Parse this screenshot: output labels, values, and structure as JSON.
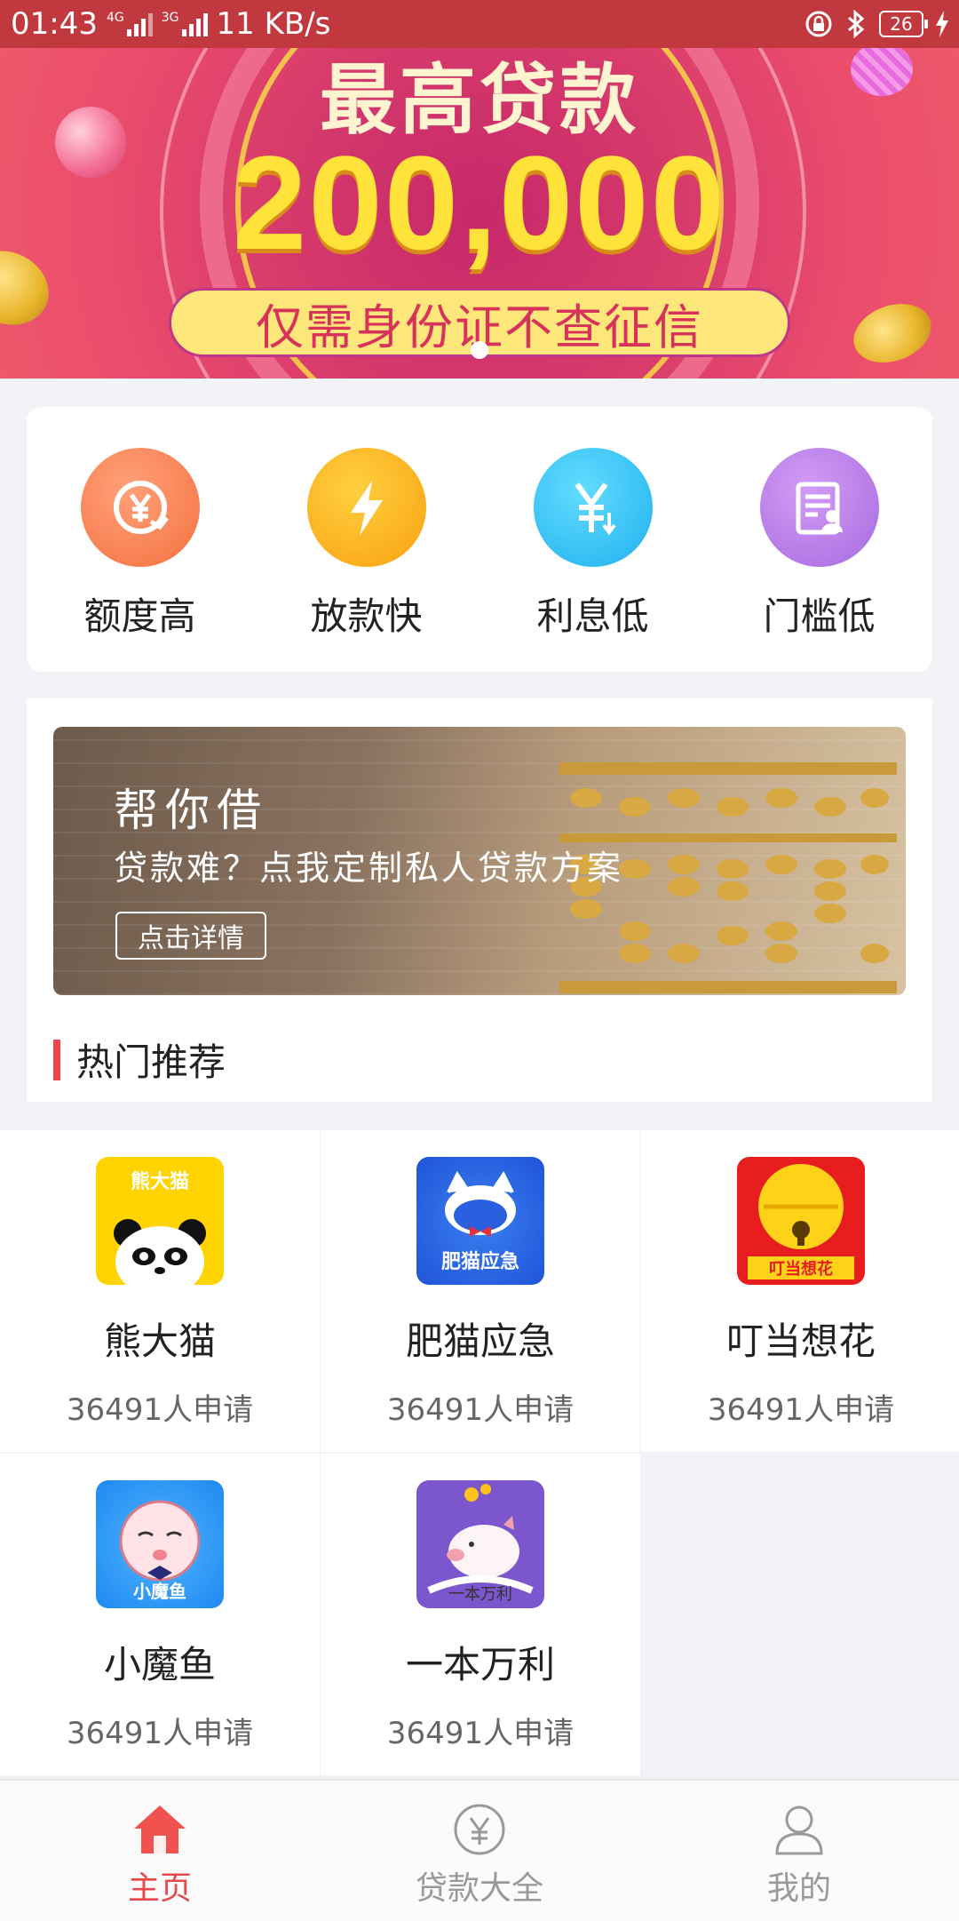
{
  "status_bar": {
    "time": "01:43",
    "net1": "4G",
    "net2": "3G",
    "speed": "11 KB/s",
    "battery": "26"
  },
  "banner": {
    "title": "最高贷款",
    "amount": "200,000",
    "subtitle": "仅需身份证不查征信"
  },
  "features": [
    {
      "label": "额度高",
      "icon": "yen-refresh-icon",
      "color": "#f77b45"
    },
    {
      "label": "放款快",
      "icon": "lightning-icon",
      "color": "#f9a712"
    },
    {
      "label": "利息低",
      "icon": "yen-down-icon",
      "color": "#27b9ef"
    },
    {
      "label": "门槛低",
      "icon": "document-user-icon",
      "color": "#b77ae6"
    }
  ],
  "promo": {
    "title": "帮你借",
    "subtitle": "贷款难？点我定制私人贷款方案",
    "button": "点击详情"
  },
  "section_title": "热门推荐",
  "products": [
    {
      "name": "熊大猫",
      "count": "36491人申请",
      "icon_text": "熊大猫"
    },
    {
      "name": "肥猫应急",
      "count": "36491人申请",
      "icon_text": "肥猫应急"
    },
    {
      "name": "叮当想花",
      "count": "36491人申请",
      "icon_text": "叮当想花"
    },
    {
      "name": "小魔鱼",
      "count": "36491人申请",
      "icon_text": "小魔鱼"
    },
    {
      "name": "一本万利",
      "count": "36491人申请",
      "icon_text": "一本万利"
    }
  ],
  "nav": [
    {
      "label": "主页",
      "icon": "home-icon",
      "active": true
    },
    {
      "label": "贷款大全",
      "icon": "yen-circle-icon",
      "active": false
    },
    {
      "label": "我的",
      "icon": "user-icon",
      "active": false
    }
  ],
  "colors": {
    "accent": "#e8484a",
    "status_bar": "#c2383f"
  }
}
